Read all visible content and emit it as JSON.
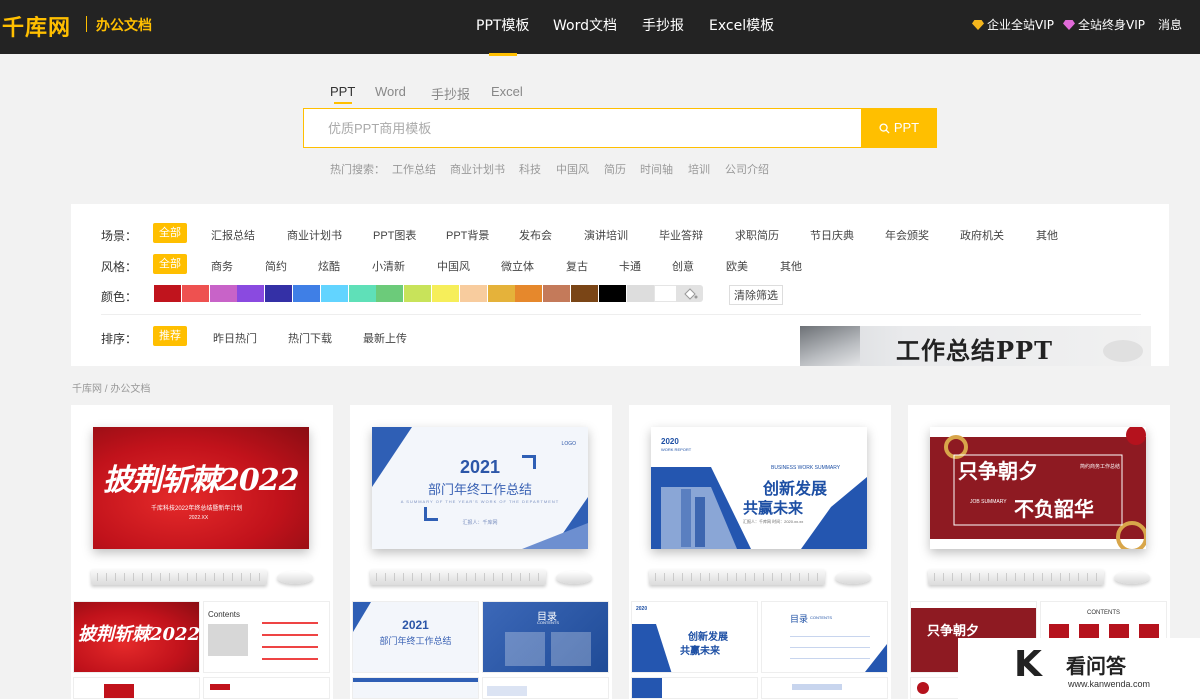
{
  "header": {
    "logo": "千库网",
    "section": "办公文档",
    "nav": [
      {
        "label": "PPT模板",
        "active": true
      },
      {
        "label": "Word文档",
        "active": false
      },
      {
        "label": "手抄报",
        "active": false
      },
      {
        "label": "Excel模板",
        "active": false
      }
    ],
    "vip_enterprise": "企业全站VIP",
    "vip_lifetime": "全站终身VIP",
    "messages": "消息"
  },
  "search": {
    "tabs": [
      "PPT",
      "Word",
      "手抄报",
      "Excel"
    ],
    "active_tab": "PPT",
    "placeholder": "优质PPT商用模板",
    "button": "PPT",
    "hot_label": "热门搜索：",
    "hot": [
      "工作总结",
      "商业计划书",
      "科技",
      "中国风",
      "简历",
      "时间轴",
      "培训",
      "公司介绍"
    ]
  },
  "filters": {
    "scene_label": "场景：",
    "scene": [
      "全部",
      "汇报总结",
      "商业计划书",
      "PPT图表",
      "PPT背景",
      "发布会",
      "演讲培训",
      "毕业答辩",
      "求职简历",
      "节日庆典",
      "年会颁奖",
      "政府机关",
      "其他"
    ],
    "style_label": "风格：",
    "style": [
      "全部",
      "商务",
      "简约",
      "炫酷",
      "小清新",
      "中国风",
      "微立体",
      "复古",
      "卡通",
      "创意",
      "欧美",
      "其他"
    ],
    "color_label": "颜色：",
    "colors": [
      "#c0141d",
      "#ee5150",
      "#c863c8",
      "#8a4ae0",
      "#3430a6",
      "#3f7fe6",
      "#62d4ff",
      "#5fe0b8",
      "#6ccb7a",
      "#c8e35a",
      "#f6ee5a",
      "#f8cc9e",
      "#e5b23a",
      "#e6882c",
      "#c47a5a",
      "#7a4516",
      "#000000",
      "#dddddd",
      "#ffffff"
    ],
    "clear": "清除筛选",
    "sort_label": "排序：",
    "sort": [
      "推荐",
      "昨日热门",
      "热门下载",
      "最新上传"
    ],
    "banner_text": "工作总结PPT"
  },
  "breadcrumb": "千库网 / 办公文档",
  "cards": [
    {
      "title": "披荆斩棘2022",
      "sub": "千库科技2022年终总结暨新年计划",
      "small": "2022.XX",
      "thumb_contents": "Contents"
    },
    {
      "logo": "LOGO",
      "year": "2021",
      "title": "部门年终工作总结",
      "en": "A SUMMARY OF THE YEAR'S WORK OF THE DEPARTMENT",
      "reporter": "汇报人：千库网",
      "thumb_title": "目录",
      "thumb_en": "CONTENTS"
    },
    {
      "year": "2020",
      "report": "WORK REPORT",
      "biz": "BUSINESS WORK SUMMARY",
      "t1": "创新发展",
      "t2": "共赢未来",
      "meta": "汇报人：千库网    时间：2020.xx.xx",
      "thumb_title": "目录",
      "thumb_en": "CONTENTS"
    },
    {
      "t1": "只争朝夕",
      "t2": "不负韶华",
      "tag": "简约商务工作总结",
      "en": "JOB SUMMARY",
      "thumb_contents": "CONTENTS"
    }
  ],
  "watermark": {
    "brand": "看问答",
    "url": "www.kanwenda.com"
  }
}
